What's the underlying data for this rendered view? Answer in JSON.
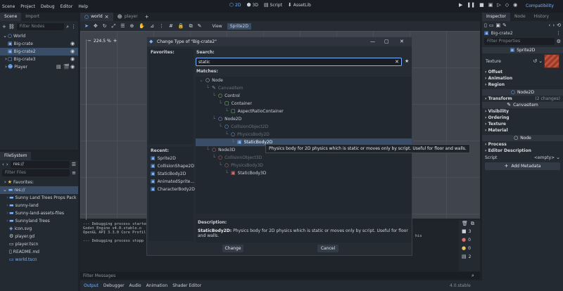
{
  "menubar": {
    "items": [
      "Scene",
      "Project",
      "Debug",
      "Editor",
      "Help"
    ],
    "workspaces": [
      {
        "icon": "2d-icon",
        "label": "2D"
      },
      {
        "icon": "3d-icon",
        "label": "3D"
      },
      {
        "icon": "script-icon",
        "label": "Script"
      },
      {
        "icon": "assetlib-icon",
        "label": "AssetLib"
      }
    ],
    "renderer": "Compatibility",
    "accent": "#7ab3ff"
  },
  "scene_dock": {
    "tabs": [
      "Scene",
      "Import"
    ],
    "filter_placeholder": "Filter Nodes",
    "nodes": [
      {
        "label": "World",
        "indent": 0,
        "selected": false
      },
      {
        "label": "Big-crate",
        "indent": 1,
        "selected": false
      },
      {
        "label": "Big-crate2",
        "indent": 1,
        "selected": true
      },
      {
        "label": "Big-crate3",
        "indent": 1,
        "selected": false
      },
      {
        "label": "Player",
        "indent": 1,
        "selected": false
      }
    ]
  },
  "filesystem_dock": {
    "tab": "FileSystem",
    "path": "res://",
    "filter_placeholder": "Filter Files",
    "favorites_label": "Favorites:",
    "items": [
      {
        "label": "res://",
        "type": "folder",
        "selected": true,
        "indent": 0
      },
      {
        "label": "Sunny Land Trees Props Pack",
        "type": "folder",
        "indent": 1
      },
      {
        "label": "sunny-land",
        "type": "folder",
        "indent": 1
      },
      {
        "label": "Sunny-land-assets-files",
        "type": "folder",
        "indent": 1
      },
      {
        "label": "Sunnyland Trees",
        "type": "folder",
        "indent": 1
      },
      {
        "label": "icon.svg",
        "type": "file",
        "indent": 1
      },
      {
        "label": "player.gd",
        "type": "file",
        "indent": 1
      },
      {
        "label": "player.tscn",
        "type": "file",
        "indent": 1
      },
      {
        "label": "README.md",
        "type": "file",
        "indent": 1
      },
      {
        "label": "world.tscn",
        "type": "scene",
        "indent": 1
      }
    ]
  },
  "editor_tabs": [
    "world",
    "player"
  ],
  "viewport": {
    "zoom": "224.5 %",
    "toolbar_view": "View",
    "toolbar_node": "Sprite2D"
  },
  "output": {
    "lines": [
      "--- Debugging process started ---",
      "Godot Engine v4.0.stable.o",
      "OpenGL API 3.3.0 Core Profil",
      "",
      "--- Debugging process stopp"
    ],
    "right_fragment": "his",
    "filter_placeholder": "Filter Messages",
    "counts": [
      "3",
      "0",
      "0",
      "2"
    ],
    "bottom_tabs": [
      "Output",
      "Debugger",
      "Audio",
      "Animation",
      "Shader Editor"
    ],
    "version": "4.0.stable"
  },
  "inspector": {
    "tabs": [
      "Inspector",
      "Node",
      "History"
    ],
    "object": "Big-crate2",
    "filter_placeholder": "Filter Properties",
    "class_header": "Sprite2D",
    "texture_label": "Texture",
    "groups_a": [
      "Offset",
      "Animation",
      "Region"
    ],
    "node2d_header": "Node2D",
    "transform": {
      "label": "Transform",
      "changes": "(2 changes)"
    },
    "canvasitem_header": "CanvasItem",
    "groups_b": [
      "Visibility",
      "Ordering",
      "Texture",
      "Material"
    ],
    "node_header": "Node",
    "groups_c": [
      "Process",
      "Editor Description"
    ],
    "script": {
      "label": "Script",
      "value": "<empty>"
    },
    "add_metadata": "Add Metadata"
  },
  "dialog": {
    "title": "Change Type of \"Big-crate2\"",
    "favorites_label": "Favorites:",
    "search_label": "Search:",
    "search_value": "static",
    "matches_label": "Matches:",
    "recent_label": "Recent:",
    "recent": [
      {
        "label": "Sprite2D",
        "color": "#7ab3ff"
      },
      {
        "label": "CollisionShape2D",
        "color": "#7ab3ff"
      },
      {
        "label": "StaticBody2D",
        "color": "#7ab3ff"
      },
      {
        "label": "AnimatedSprite...",
        "color": "#7ab3ff"
      },
      {
        "label": "CharacterBody2D",
        "color": "#7ab3ff"
      }
    ],
    "tree": [
      {
        "label": "Node",
        "indent": 0,
        "icon": "circle",
        "state": "normal"
      },
      {
        "label": "CanvasItem",
        "indent": 1,
        "icon": "pencil",
        "state": "dim"
      },
      {
        "label": "Control",
        "indent": 2,
        "icon": "circle-green",
        "state": "normal"
      },
      {
        "label": "Container",
        "indent": 3,
        "icon": "box-green",
        "state": "normal"
      },
      {
        "label": "AspectRatioContainer",
        "indent": 4,
        "icon": "box-green",
        "state": "normal"
      },
      {
        "label": "Node2D",
        "indent": 2,
        "icon": "circle-blue",
        "state": "normal"
      },
      {
        "label": "CollisionObject2D",
        "indent": 3,
        "icon": "circle-blue",
        "state": "dim"
      },
      {
        "label": "PhysicsBody2D",
        "indent": 4,
        "icon": "circle-blue",
        "state": "dim"
      },
      {
        "label": "StaticBody2D",
        "indent": 5,
        "icon": "box-blue",
        "state": "selected"
      },
      {
        "label": "Node3D",
        "indent": 1,
        "icon": "circle-red",
        "state": "normal"
      },
      {
        "label": "CollisionObject3D",
        "indent": 2,
        "icon": "circle-red",
        "state": "dim"
      },
      {
        "label": "PhysicsBody3D",
        "indent": 3,
        "icon": "circle-red",
        "state": "dim"
      },
      {
        "label": "StaticBody3D",
        "indent": 4,
        "icon": "box-red",
        "state": "normal"
      }
    ],
    "tooltip": "Physics body for 2D physics which is static or moves only by script. Useful for floor and walls.",
    "description_label": "Description:",
    "description_name": "StaticBody2D:",
    "description_text": "Physics body for 2D physics which is static or moves only by script. Useful for floor and walls.",
    "change_button": "Change",
    "cancel_button": "Cancel"
  }
}
